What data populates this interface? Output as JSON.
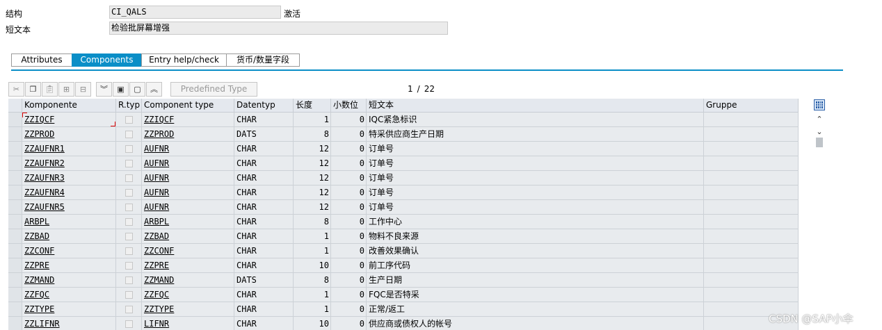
{
  "header": {
    "structure_label": "结构",
    "structure_value": "CI_QALS",
    "status": "激活",
    "short_text_label": "短文本",
    "short_text_value": "检验批屏幕增强"
  },
  "tabs": [
    {
      "label": "Attributes",
      "active": false
    },
    {
      "label": "Components",
      "active": true
    },
    {
      "label": "Entry help/check",
      "active": false
    },
    {
      "label": "货币/数量字段",
      "active": false
    }
  ],
  "toolbar": {
    "predefined_type_label": "Predefined Type",
    "icons": [
      "cut-icon",
      "copy-icon",
      "paste-icon",
      "insert-row-icon",
      "delete-row-icon",
      "collapse-icon",
      "select-all-icon",
      "deselect-icon",
      "expand-icon"
    ]
  },
  "pager": {
    "current": "1",
    "separator": "/",
    "total": "22"
  },
  "columns": {
    "komponente": "Komponente",
    "rtyp": "R.typ",
    "component_type": "Component type",
    "datentyp": "Datentyp",
    "length": "长度",
    "decimals": "小数位",
    "short_text": "短文本",
    "gruppe": "Gruppe"
  },
  "rows": [
    {
      "komp": "ZZIQCF",
      "ctype": "ZZIQCF",
      "dtyp": "CHAR",
      "len": "1",
      "dec": "0",
      "text": "IQC紧急标识"
    },
    {
      "komp": "ZZPROD",
      "ctype": "ZZPROD",
      "dtyp": "DATS",
      "len": "8",
      "dec": "0",
      "text": "特采供应商生产日期"
    },
    {
      "komp": "ZZAUFNR1",
      "ctype": "AUFNR",
      "dtyp": "CHAR",
      "len": "12",
      "dec": "0",
      "text": "订单号"
    },
    {
      "komp": "ZZAUFNR2",
      "ctype": "AUFNR",
      "dtyp": "CHAR",
      "len": "12",
      "dec": "0",
      "text": "订单号"
    },
    {
      "komp": "ZZAUFNR3",
      "ctype": "AUFNR",
      "dtyp": "CHAR",
      "len": "12",
      "dec": "0",
      "text": "订单号"
    },
    {
      "komp": "ZZAUFNR4",
      "ctype": "AUFNR",
      "dtyp": "CHAR",
      "len": "12",
      "dec": "0",
      "text": "订单号"
    },
    {
      "komp": "ZZAUFNR5",
      "ctype": "AUFNR",
      "dtyp": "CHAR",
      "len": "12",
      "dec": "0",
      "text": "订单号"
    },
    {
      "komp": "ARBPL",
      "ctype": "ARBPL",
      "dtyp": "CHAR",
      "len": "8",
      "dec": "0",
      "text": "工作中心"
    },
    {
      "komp": "ZZBAD",
      "ctype": "ZZBAD",
      "dtyp": "CHAR",
      "len": "1",
      "dec": "0",
      "text": "物料不良来源"
    },
    {
      "komp": "ZZCONF",
      "ctype": "ZZCONF",
      "dtyp": "CHAR",
      "len": "1",
      "dec": "0",
      "text": "改善效果确认"
    },
    {
      "komp": "ZZPRE",
      "ctype": "ZZPRE",
      "dtyp": "CHAR",
      "len": "10",
      "dec": "0",
      "text": "前工序代码"
    },
    {
      "komp": "ZZMAND",
      "ctype": "ZZMAND",
      "dtyp": "DATS",
      "len": "8",
      "dec": "0",
      "text": "生产日期"
    },
    {
      "komp": "ZZFQC",
      "ctype": "ZZFQC",
      "dtyp": "CHAR",
      "len": "1",
      "dec": "0",
      "text": "FQC是否特采"
    },
    {
      "komp": "ZZTYPE",
      "ctype": "ZZTYPE",
      "dtyp": "CHAR",
      "len": "1",
      "dec": "0",
      "text": "正常/返工"
    },
    {
      "komp": "ZZLIFNR",
      "ctype": "LIFNR",
      "dtyp": "CHAR",
      "len": "10",
      "dec": "0",
      "text": "供应商或债权人的帐号"
    }
  ],
  "watermark": "CSDN @SAP小伞"
}
